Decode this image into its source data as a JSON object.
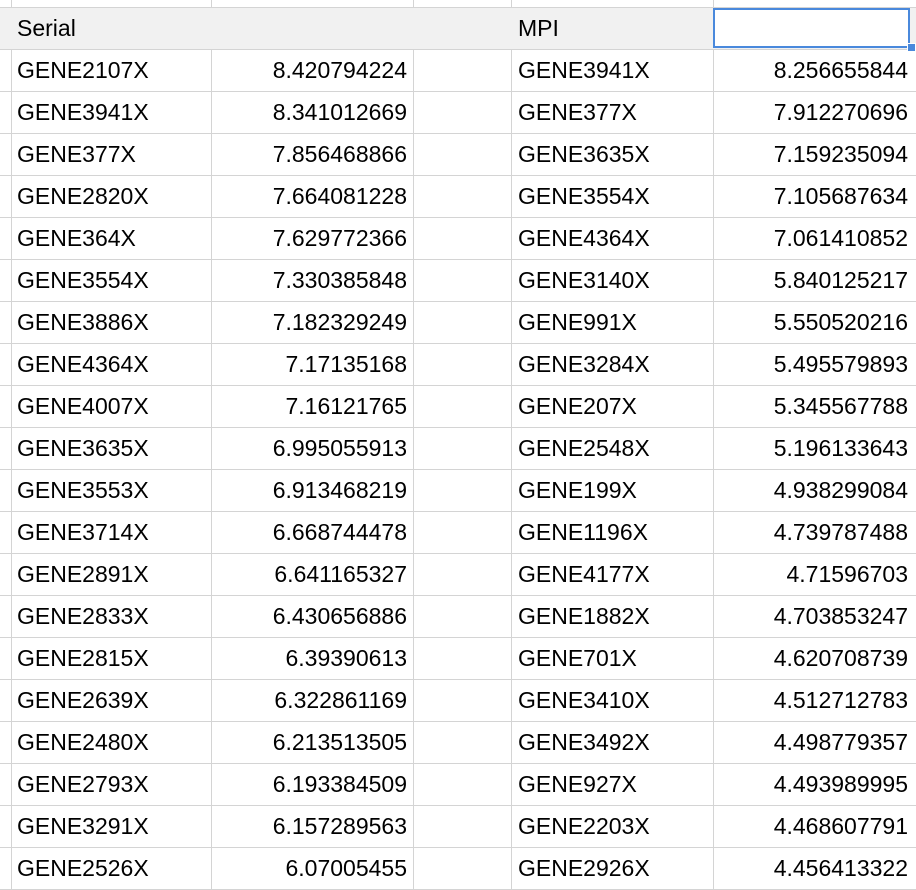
{
  "spreadsheet": {
    "header": {
      "col_a": "Serial",
      "col_b": "",
      "col_c": "",
      "col_d": "MPI",
      "col_e": ""
    },
    "rows": [
      {
        "serial_gene": "GENE2107X",
        "serial_value": "8.420794224",
        "mpi_gene": "GENE3941X",
        "mpi_value": "8.256655844"
      },
      {
        "serial_gene": "GENE3941X",
        "serial_value": "8.341012669",
        "mpi_gene": "GENE377X",
        "mpi_value": "7.912270696"
      },
      {
        "serial_gene": "GENE377X",
        "serial_value": "7.856468866",
        "mpi_gene": "GENE3635X",
        "mpi_value": "7.159235094"
      },
      {
        "serial_gene": "GENE2820X",
        "serial_value": "7.664081228",
        "mpi_gene": "GENE3554X",
        "mpi_value": "7.105687634"
      },
      {
        "serial_gene": "GENE364X",
        "serial_value": "7.629772366",
        "mpi_gene": "GENE4364X",
        "mpi_value": "7.061410852"
      },
      {
        "serial_gene": "GENE3554X",
        "serial_value": "7.330385848",
        "mpi_gene": "GENE3140X",
        "mpi_value": "5.840125217"
      },
      {
        "serial_gene": "GENE3886X",
        "serial_value": "7.182329249",
        "mpi_gene": "GENE991X",
        "mpi_value": "5.550520216"
      },
      {
        "serial_gene": "GENE4364X",
        "serial_value": "7.17135168",
        "mpi_gene": "GENE3284X",
        "mpi_value": "5.495579893"
      },
      {
        "serial_gene": "GENE4007X",
        "serial_value": "7.16121765",
        "mpi_gene": "GENE207X",
        "mpi_value": "5.345567788"
      },
      {
        "serial_gene": "GENE3635X",
        "serial_value": "6.995055913",
        "mpi_gene": "GENE2548X",
        "mpi_value": "5.196133643"
      },
      {
        "serial_gene": "GENE3553X",
        "serial_value": "6.913468219",
        "mpi_gene": "GENE199X",
        "mpi_value": "4.938299084"
      },
      {
        "serial_gene": "GENE3714X",
        "serial_value": "6.668744478",
        "mpi_gene": "GENE1196X",
        "mpi_value": "4.739787488"
      },
      {
        "serial_gene": "GENE2891X",
        "serial_value": "6.641165327",
        "mpi_gene": "GENE4177X",
        "mpi_value": "4.71596703"
      },
      {
        "serial_gene": "GENE2833X",
        "serial_value": "6.430656886",
        "mpi_gene": "GENE1882X",
        "mpi_value": "4.703853247"
      },
      {
        "serial_gene": "GENE2815X",
        "serial_value": "6.39390613",
        "mpi_gene": "GENE701X",
        "mpi_value": "4.620708739"
      },
      {
        "serial_gene": "GENE2639X",
        "serial_value": "6.322861169",
        "mpi_gene": "GENE3410X",
        "mpi_value": "4.512712783"
      },
      {
        "serial_gene": "GENE2480X",
        "serial_value": "6.213513505",
        "mpi_gene": "GENE3492X",
        "mpi_value": "4.498779357"
      },
      {
        "serial_gene": "GENE2793X",
        "serial_value": "6.193384509",
        "mpi_gene": "GENE927X",
        "mpi_value": "4.493989995"
      },
      {
        "serial_gene": "GENE3291X",
        "serial_value": "6.157289563",
        "mpi_gene": "GENE2203X",
        "mpi_value": "4.468607791"
      },
      {
        "serial_gene": "GENE2526X",
        "serial_value": "6.07005455",
        "mpi_gene": "GENE2926X",
        "mpi_value": "4.456413322"
      }
    ],
    "selected_cell": {
      "column": "E",
      "row": 1
    }
  },
  "colors": {
    "grid_line": "#d4d4d4",
    "header_fill": "#f1f1f1",
    "selection": "#4a89dc",
    "text": "#000000"
  }
}
